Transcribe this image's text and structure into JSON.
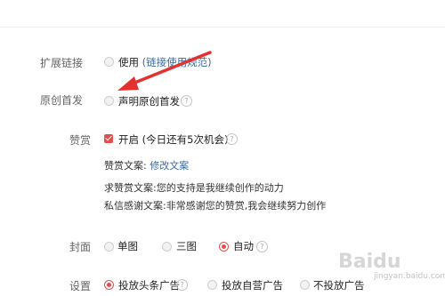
{
  "rows": {
    "ext_link": {
      "label": "扩展链接",
      "option": "使用",
      "link_text": "(链接使用规范)"
    },
    "original": {
      "label": "原创首发",
      "option": "声明原创首发",
      "help": "?"
    },
    "reward": {
      "label": "赞赏",
      "option": "开启",
      "note": "(今日还有5次机会)",
      "help": "?",
      "copy_label": "赞赏文案:",
      "copy_link": "修改文案",
      "request_copy": "求赞赏文案:您的支持是我继续创作的动力",
      "thanks_copy": "私信感谢文案:非常感谢您的赞赏,我会继续努力创作"
    },
    "cover": {
      "label": "封面",
      "options": [
        "单图",
        "三图",
        "自动"
      ],
      "selected": "自动",
      "help": "?"
    },
    "settings": {
      "label": "设置",
      "options": [
        "投放头条广告",
        "投放自营广告",
        "不投放广告"
      ],
      "selected": "投放头条广告",
      "help": "?"
    }
  },
  "watermark": {
    "logo": "Baidu",
    "sub": "jingyan.baidu.com"
  },
  "colors": {
    "accent": "#e54d4d",
    "link": "#3b6aa3",
    "annotation_arrow": "#e53030"
  }
}
